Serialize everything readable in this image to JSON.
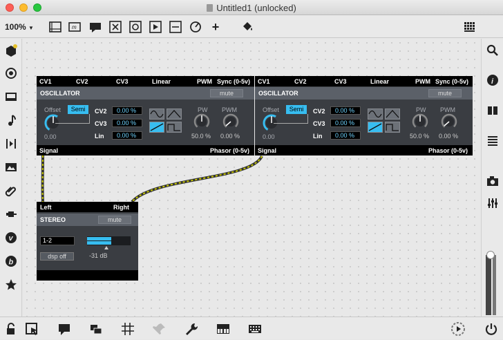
{
  "window": {
    "title": "Untitled1 (unlocked)"
  },
  "toolbar": {
    "zoom": "100%",
    "zoom_caret": "▼"
  },
  "oscillators": [
    {
      "inputs": [
        "CV1",
        "CV2",
        "CV3",
        "Linear",
        "PWM",
        "Sync (0-5v)"
      ],
      "name": "OSCILLATOR",
      "mute": "mute",
      "offset_label": "Offset",
      "semi": "Semi",
      "offset_value": "0.00",
      "cv2_label": "CV2",
      "cv2": "0.00 %",
      "cv3_label": "CV3",
      "cv3": "0.00 %",
      "lin_label": "Lin",
      "lin": "0.00 %",
      "pw_label": "PW",
      "pw": "50.0 %",
      "pwm_label": "PWM",
      "pwm": "0.00 %",
      "outputs": [
        "Signal",
        "Phasor (0-5v)"
      ]
    },
    {
      "inputs": [
        "CV1",
        "CV2",
        "CV3",
        "Linear",
        "PWM",
        "Sync (0-5v)"
      ],
      "name": "OSCILLATOR",
      "mute": "mute",
      "offset_label": "Offset",
      "semi": "Semi",
      "offset_value": "0.00",
      "cv2_label": "CV2",
      "cv2": "0.00 %",
      "cv3_label": "CV3",
      "cv3": "0.00 %",
      "lin_label": "Lin",
      "lin": "0.00 %",
      "pw_label": "PW",
      "pw": "50.0 %",
      "pwm_label": "PWM",
      "pwm": "0.00 %",
      "outputs": [
        "Signal",
        "Phasor (0-5v)"
      ]
    }
  ],
  "stereo": {
    "inputs": [
      "Left",
      "Right"
    ],
    "name": "STEREO",
    "mute": "mute",
    "channels": "1-2",
    "dsp": "dsp off",
    "level": "-31 dB",
    "meter_level": 0.55
  },
  "colors": {
    "accent": "#37bdf0",
    "module_bg": "#3a3d42",
    "cable": "#c8c800"
  },
  "sidebar_right_icons": [
    "search-icon",
    "info-icon",
    "columns-icon",
    "list-icon",
    "camera-icon",
    "sliders-icon",
    "volume-slider"
  ],
  "sidebar_left_icons": [
    "package-icon",
    "circle-icon",
    "tv-icon",
    "music-note-icon",
    "step-icon",
    "image-icon",
    "paperclip-icon",
    "plug-icon",
    "v-icon",
    "b-icon",
    "star-icon"
  ],
  "bottom_icons": [
    "lock-icon",
    "select-icon",
    "comment-icon",
    "windows-icon",
    "grid-icon",
    "pin-icon",
    "wrench-icon",
    "piano-icon",
    "keyboard-icon",
    "play-icon",
    "power-icon"
  ]
}
